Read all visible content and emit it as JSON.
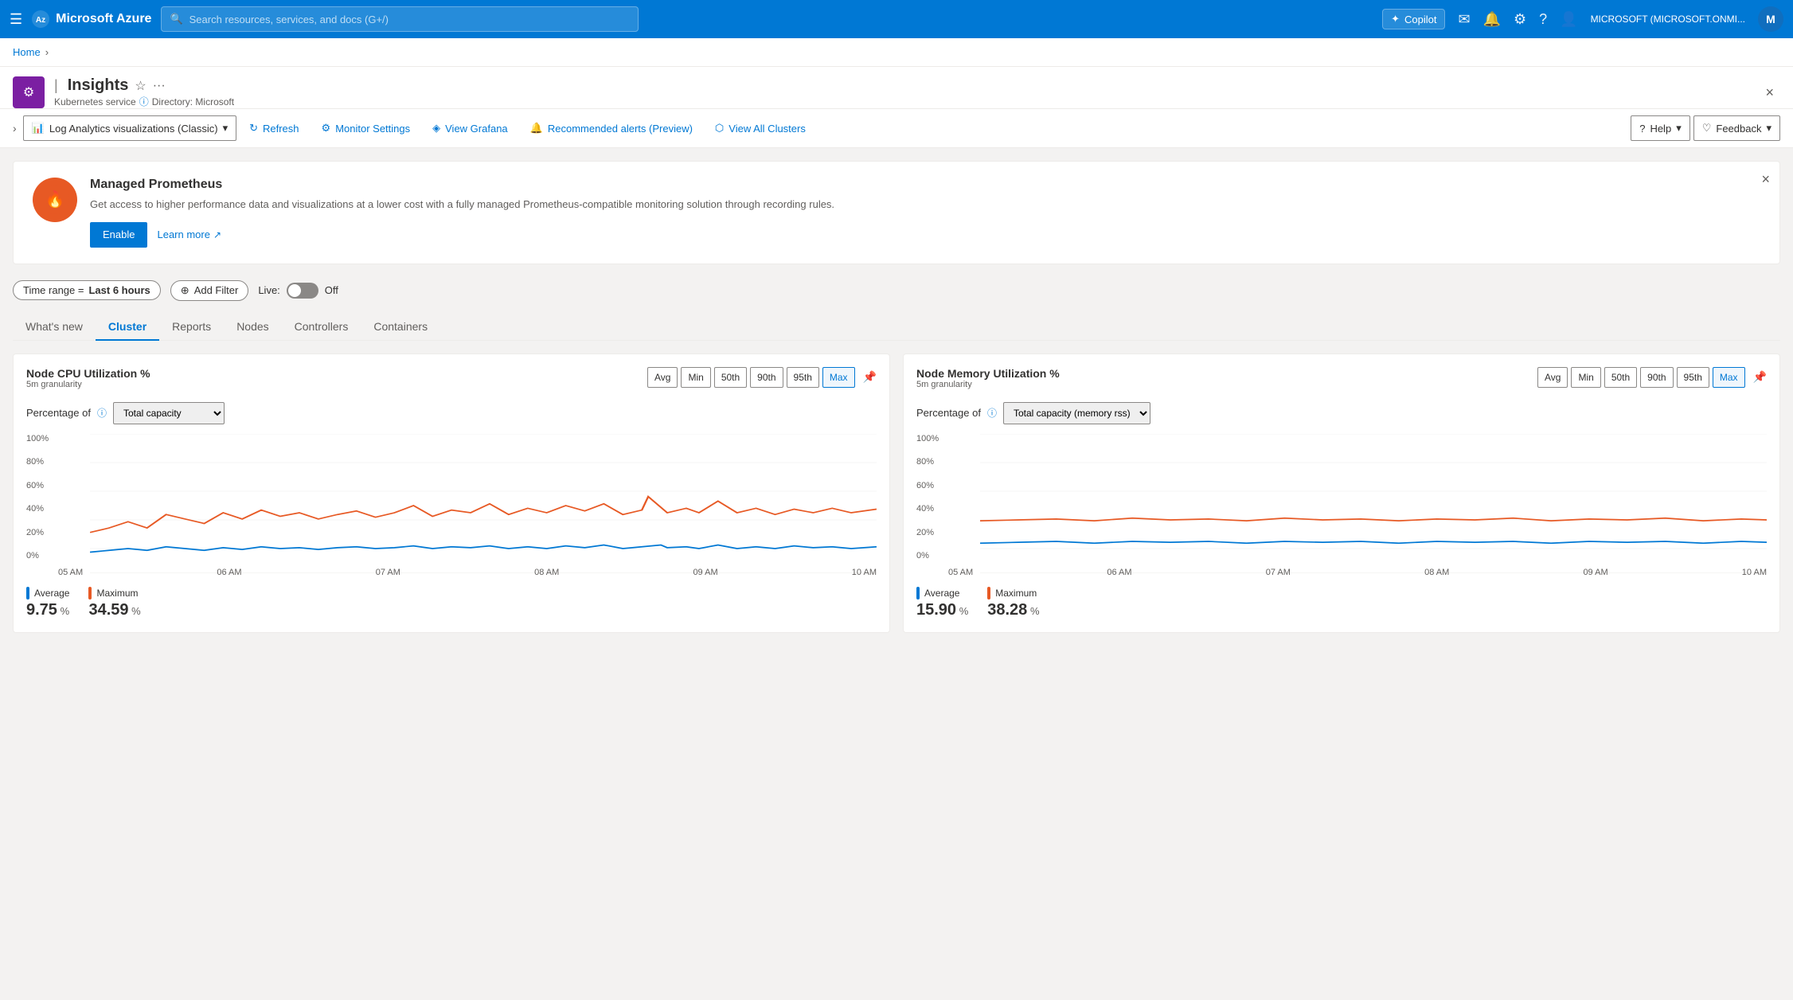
{
  "topbar": {
    "menu_label": "☰",
    "logo": "Microsoft Azure",
    "search_placeholder": "Search resources, services, and docs (G+/)",
    "copilot_label": "Copilot",
    "account_label": "MICROSOFT (MICROSOFT.ONMI...",
    "avatar_letter": "M"
  },
  "breadcrumb": {
    "home": "Home",
    "separator": "›"
  },
  "page": {
    "service": "Kubernetes service",
    "directory": "Directory: Microsoft",
    "title": "Insights",
    "close_label": "×"
  },
  "toolbar": {
    "view_dropdown": "Log Analytics visualizations (Classic)",
    "refresh_label": "Refresh",
    "monitor_settings_label": "Monitor Settings",
    "view_grafana_label": "View Grafana",
    "recommended_alerts_label": "Recommended alerts (Preview)",
    "view_all_clusters_label": "View All Clusters",
    "help_label": "Help",
    "feedback_label": "Feedback"
  },
  "banner": {
    "title": "Managed Prometheus",
    "description": "Get access to higher performance data and visualizations at a lower cost with a fully managed Prometheus-compatible monitoring solution through recording rules.",
    "enable_label": "Enable",
    "learn_more_label": "Learn more"
  },
  "filters": {
    "time_range_label": "Time range",
    "time_range_value": "Last 6 hours",
    "add_filter_label": "Add Filter",
    "live_label": "Live:",
    "live_state": "Off"
  },
  "tabs": [
    {
      "id": "whats-new",
      "label": "What's new"
    },
    {
      "id": "cluster",
      "label": "Cluster",
      "active": true
    },
    {
      "id": "reports",
      "label": "Reports"
    },
    {
      "id": "nodes",
      "label": "Nodes"
    },
    {
      "id": "controllers",
      "label": "Controllers"
    },
    {
      "id": "containers",
      "label": "Containers"
    }
  ],
  "charts": {
    "cpu": {
      "title": "Node CPU Utilization %",
      "granularity": "5m granularity",
      "metrics": [
        "Avg",
        "Min",
        "50th",
        "90th",
        "95th",
        "Max"
      ],
      "active_metric": "Max",
      "percentage_label": "Percentage of",
      "percentage_option": "Total capacity",
      "y_axis": [
        "100%",
        "80%",
        "60%",
        "40%",
        "20%",
        "0%"
      ],
      "x_axis": [
        "05 AM",
        "06 AM",
        "07 AM",
        "08 AM",
        "09 AM",
        "10 AM"
      ],
      "stats": [
        {
          "label": "Average",
          "color": "#0078d4",
          "value": "9.75",
          "unit": "%"
        },
        {
          "label": "Maximum",
          "color": "#e75924",
          "value": "34.59",
          "unit": "%"
        }
      ]
    },
    "memory": {
      "title": "Node Memory Utilization %",
      "granularity": "5m granularity",
      "metrics": [
        "Avg",
        "Min",
        "50th",
        "90th",
        "95th",
        "Max"
      ],
      "active_metric": "Max",
      "percentage_label": "Percentage of",
      "percentage_option": "Total capacity (memory rss)",
      "y_axis": [
        "100%",
        "80%",
        "60%",
        "40%",
        "20%",
        "0%"
      ],
      "x_axis": [
        "05 AM",
        "06 AM",
        "07 AM",
        "08 AM",
        "09 AM",
        "10 AM"
      ],
      "stats": [
        {
          "label": "Average",
          "color": "#0078d4",
          "value": "15.90",
          "unit": "%"
        },
        {
          "label": "Maximum",
          "color": "#e75924",
          "value": "38.28",
          "unit": "%"
        }
      ]
    }
  }
}
